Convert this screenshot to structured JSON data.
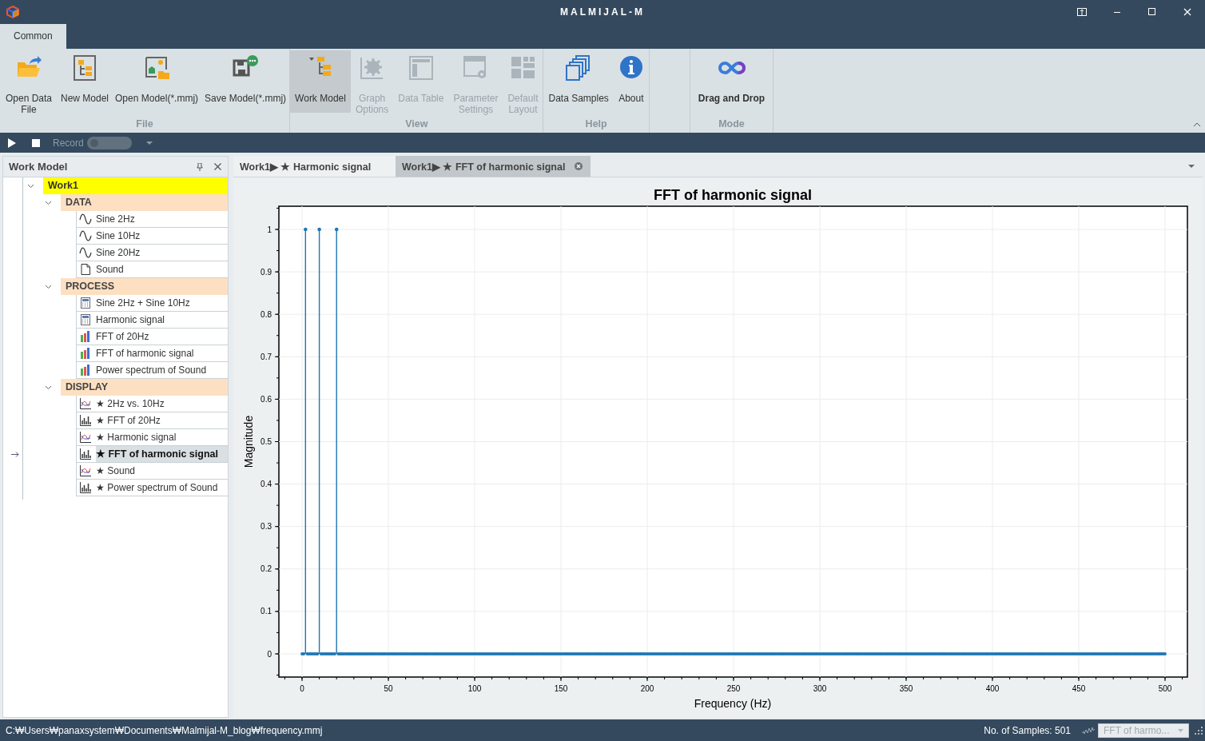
{
  "window": {
    "title": "MALMIJAL-M"
  },
  "ribbon": {
    "tabs": [
      {
        "label": "Common",
        "selected": true
      }
    ],
    "groups": [
      {
        "label": "File",
        "buttons": [
          {
            "label": "Open Data File",
            "selected": false,
            "disabled": false,
            "bold": false
          },
          {
            "label": "New Model",
            "selected": false,
            "disabled": false,
            "bold": false
          },
          {
            "label": "Open Model(*.mmj)",
            "selected": false,
            "disabled": false,
            "bold": false
          },
          {
            "label": "Save Model(*.mmj)",
            "selected": false,
            "disabled": false,
            "bold": false
          }
        ]
      },
      {
        "label": "View",
        "buttons": [
          {
            "label": "Work Model",
            "selected": true,
            "disabled": false,
            "bold": false
          },
          {
            "label": "Graph Options",
            "selected": false,
            "disabled": true,
            "bold": false
          },
          {
            "label": "Data Table",
            "selected": false,
            "disabled": true,
            "bold": false
          },
          {
            "label": "Parameter Settings",
            "selected": false,
            "disabled": true,
            "bold": false
          },
          {
            "label": "Default Layout",
            "selected": false,
            "disabled": true,
            "bold": false
          }
        ]
      },
      {
        "label": "Help",
        "buttons": [
          {
            "label": "Data Samples",
            "selected": false,
            "disabled": false,
            "bold": false
          },
          {
            "label": "About",
            "selected": false,
            "disabled": false,
            "bold": false
          }
        ]
      },
      {
        "label": "Mode",
        "buttons": [
          {
            "label": "Drag and Drop",
            "selected": false,
            "disabled": false,
            "bold": true
          }
        ]
      }
    ]
  },
  "toolbar": {
    "record_label": "Record",
    "record_on": false
  },
  "work_model": {
    "title": "Work Model",
    "tree": [
      {
        "label": "Work1",
        "kind": "root",
        "expanded": true,
        "selected": false,
        "children": [
          {
            "label": "DATA",
            "kind": "group",
            "expanded": true,
            "selected": false,
            "children": [
              {
                "label": "Sine 2Hz",
                "kind": "signal",
                "selected": false
              },
              {
                "label": "Sine 10Hz",
                "kind": "signal",
                "selected": false
              },
              {
                "label": "Sine 20Hz",
                "kind": "signal",
                "selected": false
              },
              {
                "label": "Sound",
                "kind": "file",
                "selected": false
              }
            ]
          },
          {
            "label": "PROCESS",
            "kind": "group",
            "expanded": true,
            "selected": false,
            "children": [
              {
                "label": "Sine 2Hz + Sine 10Hz",
                "kind": "calc",
                "selected": false
              },
              {
                "label": "Harmonic signal",
                "kind": "calc",
                "selected": false
              },
              {
                "label": "FFT of 20Hz",
                "kind": "fft",
                "selected": false
              },
              {
                "label": "FFT of harmonic signal",
                "kind": "fft",
                "selected": false
              },
              {
                "label": "Power spectrum of Sound",
                "kind": "fft",
                "selected": false
              }
            ]
          },
          {
            "label": "DISPLAY",
            "kind": "group",
            "expanded": true,
            "selected": false,
            "children": [
              {
                "label": "★ 2Hz vs. 10Hz",
                "kind": "line-plot",
                "selected": false
              },
              {
                "label": "★ FFT of 20Hz",
                "kind": "bar-plot",
                "selected": false
              },
              {
                "label": "★ Harmonic signal",
                "kind": "line-plot",
                "selected": false
              },
              {
                "label": "★ FFT of harmonic signal",
                "kind": "bar-plot",
                "selected": true
              },
              {
                "label": "★ Sound",
                "kind": "line-plot",
                "selected": false
              },
              {
                "label": "★ Power spectrum of Sound",
                "kind": "bar-plot",
                "selected": false
              }
            ]
          }
        ]
      }
    ]
  },
  "documents": {
    "tabs": [
      {
        "label": "Work1▶ ★ Harmonic signal",
        "selected": false
      },
      {
        "label": "Work1▶ ★ FFT of harmonic signal",
        "selected": true
      }
    ],
    "chart_data": {
      "type": "bar",
      "title": "FFT of harmonic signal",
      "xlabel": "Frequency (Hz)",
      "ylabel": "Magnitude",
      "xlim": [
        0,
        500
      ],
      "ylim": [
        0,
        1
      ],
      "grid": true,
      "xticks": [
        0,
        50,
        100,
        150,
        200,
        250,
        300,
        350,
        400,
        450,
        500
      ],
      "yticks": [
        0,
        0.1,
        0.2,
        0.3,
        0.4,
        0.5,
        0.6,
        0.7,
        0.8,
        0.9,
        1
      ],
      "x": [
        0,
        1,
        2,
        3,
        4,
        5,
        6,
        7,
        8,
        9,
        10,
        11,
        12,
        13,
        14,
        15,
        16,
        17,
        18,
        19,
        20,
        21,
        22,
        23,
        24,
        25,
        26,
        27,
        28,
        29,
        30,
        31,
        32,
        33,
        34,
        35,
        36,
        37,
        38,
        39,
        40,
        41,
        42,
        43,
        44,
        45,
        46,
        47,
        48,
        49,
        50,
        51,
        52,
        53,
        54,
        55,
        56,
        57,
        58,
        59,
        60,
        61,
        62,
        63,
        64,
        65,
        66,
        67,
        68,
        69,
        70,
        71,
        72,
        73,
        74,
        75,
        76,
        77,
        78,
        79,
        80,
        81,
        82,
        83,
        84,
        85,
        86,
        87,
        88,
        89,
        90,
        91,
        92,
        93,
        94,
        95,
        96,
        97,
        98,
        99,
        100,
        101,
        102,
        103,
        104,
        105,
        106,
        107,
        108,
        109,
        110,
        111,
        112,
        113,
        114,
        115,
        116,
        117,
        118,
        119,
        120,
        121,
        122,
        123,
        124,
        125,
        126,
        127,
        128,
        129,
        130,
        131,
        132,
        133,
        134,
        135,
        136,
        137,
        138,
        139,
        140,
        141,
        142,
        143,
        144,
        145,
        146,
        147,
        148,
        149,
        150,
        151,
        152,
        153,
        154,
        155,
        156,
        157,
        158,
        159,
        160,
        161,
        162,
        163,
        164,
        165,
        166,
        167,
        168,
        169,
        170,
        171,
        172,
        173,
        174,
        175,
        176,
        177,
        178,
        179,
        180,
        181,
        182,
        183,
        184,
        185,
        186,
        187,
        188,
        189,
        190,
        191,
        192,
        193,
        194,
        195,
        196,
        197,
        198,
        199,
        200,
        201,
        202,
        203,
        204,
        205,
        206,
        207,
        208,
        209,
        210,
        211,
        212,
        213,
        214,
        215,
        216,
        217,
        218,
        219,
        220,
        221,
        222,
        223,
        224,
        225,
        226,
        227,
        228,
        229,
        230,
        231,
        232,
        233,
        234,
        235,
        236,
        237,
        238,
        239,
        240,
        241,
        242,
        243,
        244,
        245,
        246,
        247,
        248,
        249,
        250,
        251,
        252,
        253,
        254,
        255,
        256,
        257,
        258,
        259,
        260,
        261,
        262,
        263,
        264,
        265,
        266,
        267,
        268,
        269,
        270,
        271,
        272,
        273,
        274,
        275,
        276,
        277,
        278,
        279,
        280,
        281,
        282,
        283,
        284,
        285,
        286,
        287,
        288,
        289,
        290,
        291,
        292,
        293,
        294,
        295,
        296,
        297,
        298,
        299,
        300,
        301,
        302,
        303,
        304,
        305,
        306,
        307,
        308,
        309,
        310,
        311,
        312,
        313,
        314,
        315,
        316,
        317,
        318,
        319,
        320,
        321,
        322,
        323,
        324,
        325,
        326,
        327,
        328,
        329,
        330,
        331,
        332,
        333,
        334,
        335,
        336,
        337,
        338,
        339,
        340,
        341,
        342,
        343,
        344,
        345,
        346,
        347,
        348,
        349,
        350,
        351,
        352,
        353,
        354,
        355,
        356,
        357,
        358,
        359,
        360,
        361,
        362,
        363,
        364,
        365,
        366,
        367,
        368,
        369,
        370,
        371,
        372,
        373,
        374,
        375,
        376,
        377,
        378,
        379,
        380,
        381,
        382,
        383,
        384,
        385,
        386,
        387,
        388,
        389,
        390,
        391,
        392,
        393,
        394,
        395,
        396,
        397,
        398,
        399,
        400,
        401,
        402,
        403,
        404,
        405,
        406,
        407,
        408,
        409,
        410,
        411,
        412,
        413,
        414,
        415,
        416,
        417,
        418,
        419,
        420,
        421,
        422,
        423,
        424,
        425,
        426,
        427,
        428,
        429,
        430,
        431,
        432,
        433,
        434,
        435,
        436,
        437,
        438,
        439,
        440,
        441,
        442,
        443,
        444,
        445,
        446,
        447,
        448,
        449,
        450,
        451,
        452,
        453,
        454,
        455,
        456,
        457,
        458,
        459,
        460,
        461,
        462,
        463,
        464,
        465,
        466,
        467,
        468,
        469,
        470,
        471,
        472,
        473,
        474,
        475,
        476,
        477,
        478,
        479,
        480,
        481,
        482,
        483,
        484,
        485,
        486,
        487,
        488,
        489,
        490,
        491,
        492,
        493,
        494,
        495,
        496,
        497,
        498,
        499,
        500
      ],
      "series": [
        {
          "color": "#1f77b4",
          "values": [
            0,
            0,
            1,
            0,
            0,
            0,
            0,
            0,
            0,
            0,
            1,
            0,
            0,
            0,
            0,
            0,
            0,
            0,
            0,
            0,
            1,
            0,
            0,
            0,
            0,
            0,
            0,
            0,
            0,
            0,
            0,
            0,
            0,
            0,
            0,
            0,
            0,
            0,
            0,
            0,
            0,
            0,
            0,
            0,
            0,
            0,
            0,
            0,
            0,
            0,
            0,
            0,
            0,
            0,
            0,
            0,
            0,
            0,
            0,
            0,
            0,
            0,
            0,
            0,
            0,
            0,
            0,
            0,
            0,
            0,
            0,
            0,
            0,
            0,
            0,
            0,
            0,
            0,
            0,
            0,
            0,
            0,
            0,
            0,
            0,
            0,
            0,
            0,
            0,
            0,
            0,
            0,
            0,
            0,
            0,
            0,
            0,
            0,
            0,
            0,
            0,
            0,
            0,
            0,
            0,
            0,
            0,
            0,
            0,
            0,
            0,
            0,
            0,
            0,
            0,
            0,
            0,
            0,
            0,
            0,
            0,
            0,
            0,
            0,
            0,
            0,
            0,
            0,
            0,
            0,
            0,
            0,
            0,
            0,
            0,
            0,
            0,
            0,
            0,
            0,
            0,
            0,
            0,
            0,
            0,
            0,
            0,
            0,
            0,
            0,
            0,
            0,
            0,
            0,
            0,
            0,
            0,
            0,
            0,
            0,
            0,
            0,
            0,
            0,
            0,
            0,
            0,
            0,
            0,
            0,
            0,
            0,
            0,
            0,
            0,
            0,
            0,
            0,
            0,
            0,
            0,
            0,
            0,
            0,
            0,
            0,
            0,
            0,
            0,
            0,
            0,
            0,
            0,
            0,
            0,
            0,
            0,
            0,
            0,
            0,
            0,
            0,
            0,
            0,
            0,
            0,
            0,
            0,
            0,
            0,
            0,
            0,
            0,
            0,
            0,
            0,
            0,
            0,
            0,
            0,
            0,
            0,
            0,
            0,
            0,
            0,
            0,
            0,
            0,
            0,
            0,
            0,
            0,
            0,
            0,
            0,
            0,
            0,
            0,
            0,
            0,
            0,
            0,
            0,
            0,
            0,
            0,
            0,
            0,
            0,
            0,
            0,
            0,
            0,
            0,
            0,
            0,
            0,
            0,
            0,
            0,
            0,
            0,
            0,
            0,
            0,
            0,
            0,
            0,
            0,
            0,
            0,
            0,
            0,
            0,
            0,
            0,
            0,
            0,
            0,
            0,
            0,
            0,
            0,
            0,
            0,
            0,
            0,
            0,
            0,
            0,
            0,
            0,
            0,
            0,
            0,
            0,
            0,
            0,
            0,
            0,
            0,
            0,
            0,
            0,
            0,
            0,
            0,
            0,
            0,
            0,
            0,
            0,
            0,
            0,
            0,
            0,
            0,
            0,
            0,
            0,
            0,
            0,
            0,
            0,
            0,
            0,
            0,
            0,
            0,
            0,
            0,
            0,
            0,
            0,
            0,
            0,
            0,
            0,
            0,
            0,
            0,
            0,
            0,
            0,
            0,
            0,
            0,
            0,
            0,
            0,
            0,
            0,
            0,
            0,
            0,
            0,
            0,
            0,
            0,
            0,
            0,
            0,
            0,
            0,
            0,
            0,
            0,
            0,
            0,
            0,
            0,
            0,
            0,
            0,
            0,
            0,
            0,
            0,
            0,
            0,
            0,
            0,
            0,
            0,
            0,
            0,
            0,
            0,
            0,
            0,
            0,
            0,
            0,
            0,
            0,
            0,
            0,
            0,
            0,
            0,
            0,
            0,
            0,
            0,
            0,
            0,
            0,
            0,
            0,
            0,
            0,
            0,
            0,
            0,
            0,
            0,
            0,
            0,
            0,
            0,
            0,
            0,
            0,
            0,
            0,
            0,
            0,
            0,
            0,
            0,
            0,
            0,
            0,
            0,
            0,
            0,
            0,
            0,
            0,
            0,
            0,
            0,
            0,
            0,
            0,
            0,
            0,
            0,
            0,
            0,
            0,
            0,
            0,
            0,
            0,
            0,
            0,
            0,
            0,
            0,
            0,
            0,
            0,
            0,
            0,
            0,
            0,
            0,
            0,
            0,
            0,
            0,
            0,
            0,
            0,
            0,
            0,
            0,
            0,
            0,
            0,
            0,
            0,
            0,
            0,
            0,
            0,
            0,
            0,
            0,
            0,
            0,
            0,
            0,
            0,
            0,
            0,
            0,
            0,
            0
          ]
        }
      ]
    }
  },
  "status_bar": {
    "path": "C:₩Users₩panaxsystem₩Documents₩Malmijal-M_blog₩frequency.mmj",
    "samples": "No. of Samples: 501",
    "selector_value": "FFT of harmo..."
  }
}
